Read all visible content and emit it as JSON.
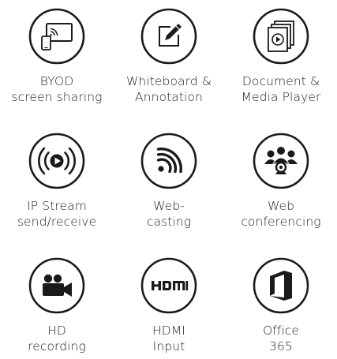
{
  "colors": {
    "stroke": "#1a1a1a",
    "fill": "#1a1a1a",
    "background": "#ffffff"
  },
  "features": [
    {
      "icon": "byod-screen-share-icon",
      "line1": "BYOD",
      "line2": "screen sharing"
    },
    {
      "icon": "whiteboard-pen-icon",
      "line1": "Whiteboard &",
      "line2": "Annotation"
    },
    {
      "icon": "document-media-player-icon",
      "line1": "Document &",
      "line2": "Media Player"
    },
    {
      "icon": "ip-stream-broadcast-icon",
      "line1": "IP Stream",
      "line2": "send/receive"
    },
    {
      "icon": "webcasting-signal-icon",
      "line1": "Web-",
      "line2": "casting"
    },
    {
      "icon": "web-conferencing-people-icon",
      "line1": "Web",
      "line2": "conferencing"
    },
    {
      "icon": "video-camera-icon",
      "line1": "HD",
      "line2": "recording"
    },
    {
      "icon": "hdmi-logo-icon",
      "line1": "HDMI",
      "line2": "Input"
    },
    {
      "icon": "office-365-logo-icon",
      "line1": "Office",
      "line2": "365"
    }
  ]
}
